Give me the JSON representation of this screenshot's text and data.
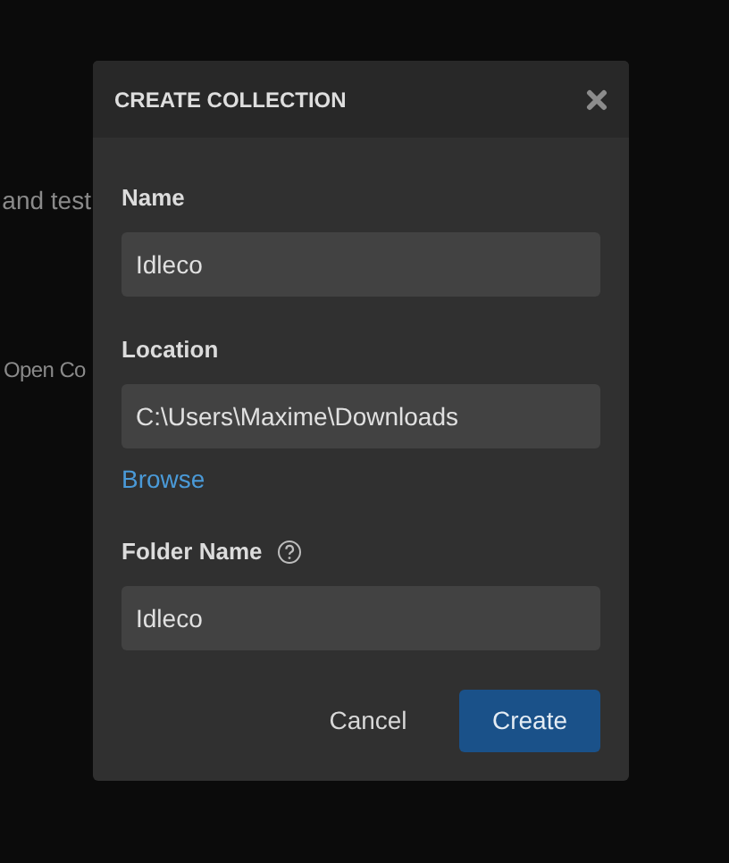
{
  "background": {
    "texts": [
      "and test",
      "Open Co"
    ]
  },
  "dialog": {
    "title": "CREATE COLLECTION",
    "fields": [
      {
        "kind": "text",
        "label": "Name",
        "value": "Idleco"
      },
      {
        "kind": "path",
        "label": "Location",
        "value": "C:\\Users\\Maxime\\Downloads",
        "link": "Browse"
      },
      {
        "kind": "help",
        "label": "Folder Name",
        "value": "Idleco"
      }
    ],
    "buttons": [
      {
        "label": "Cancel",
        "primary": false
      },
      {
        "label": "Create",
        "primary": true
      }
    ]
  }
}
